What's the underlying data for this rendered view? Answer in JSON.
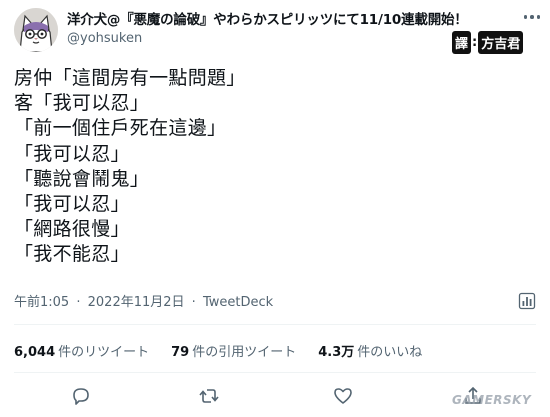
{
  "author": {
    "display_name": "洋介犬@『悪魔の論破』やわらかスピリッツにて11/10連載開始！",
    "handle": "@yohsuken",
    "avatar_icon": "cartoon-cat-avatar"
  },
  "translator": {
    "tag": "譯",
    "separator": ":",
    "name": "方吉君"
  },
  "tweet": {
    "lines": [
      "房仲「這間房有一點問題」",
      "客「我可以忍」",
      "「前一個住戶死在這邊」",
      "「我可以忍」",
      "「聽說會鬧鬼」",
      "「我可以忍」",
      "「網路很慢」",
      "「我不能忍」"
    ]
  },
  "meta": {
    "time": "午前1:05",
    "separator": "·",
    "date": "2022年11月2日",
    "client": "TweetDeck"
  },
  "stats": [
    {
      "number": "6,044",
      "label": "件のリツイート"
    },
    {
      "number": "79",
      "label": "件の引用ツイート"
    },
    {
      "number": "4.3万",
      "label": "件のいいね"
    }
  ],
  "actions": [
    {
      "icon": "reply-icon"
    },
    {
      "icon": "retweet-icon"
    },
    {
      "icon": "like-icon"
    },
    {
      "icon": "share-icon"
    }
  ],
  "watermark": "GAMERSKY",
  "colors": {
    "text": "#0f1419",
    "secondary": "#536471",
    "divider": "#eff3f4"
  }
}
